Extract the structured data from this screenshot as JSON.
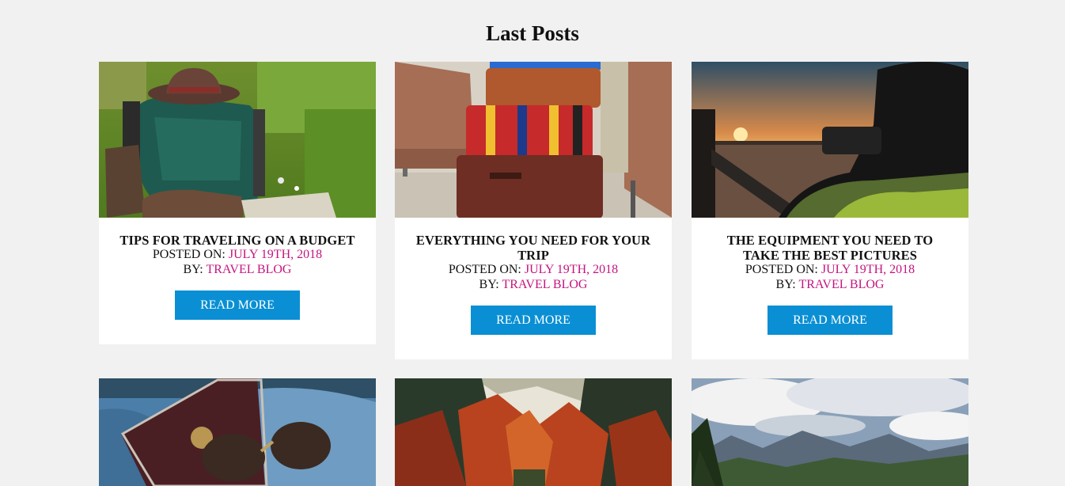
{
  "section": {
    "title": "Last Posts"
  },
  "labels": {
    "posted_on": "POSTED ON: ",
    "by": "BY: "
  },
  "colors": {
    "accent": "#c4147f",
    "button": "#0a8fd4",
    "background": "#f1f1f1"
  },
  "posts": [
    {
      "title": "TIPS FOR TRAVELING ON A BUDGET",
      "date": "JULY 19TH, 2018",
      "author": "TRAVEL BLOG",
      "button": "READ MORE",
      "image": "backpack-hat-boots-on-grass"
    },
    {
      "title": "EVERYTHING YOU NEED FOR YOUR TRIP",
      "date": "JULY 19TH, 2018",
      "author": "TRAVEL BLOG",
      "button": "READ MORE",
      "image": "stacked-vintage-suitcases"
    },
    {
      "title": "THE EQUIPMENT YOU NEED TO TAKE THE BEST PICTURES",
      "date": "JULY 19TH, 2018",
      "author": "TRAVEL BLOG",
      "button": "READ MORE",
      "image": "photographer-sunset-river"
    },
    {
      "image": "passport-sunglasses-denim"
    },
    {
      "image": "autumn-forest"
    },
    {
      "image": "mountain-valley-clouds"
    }
  ]
}
